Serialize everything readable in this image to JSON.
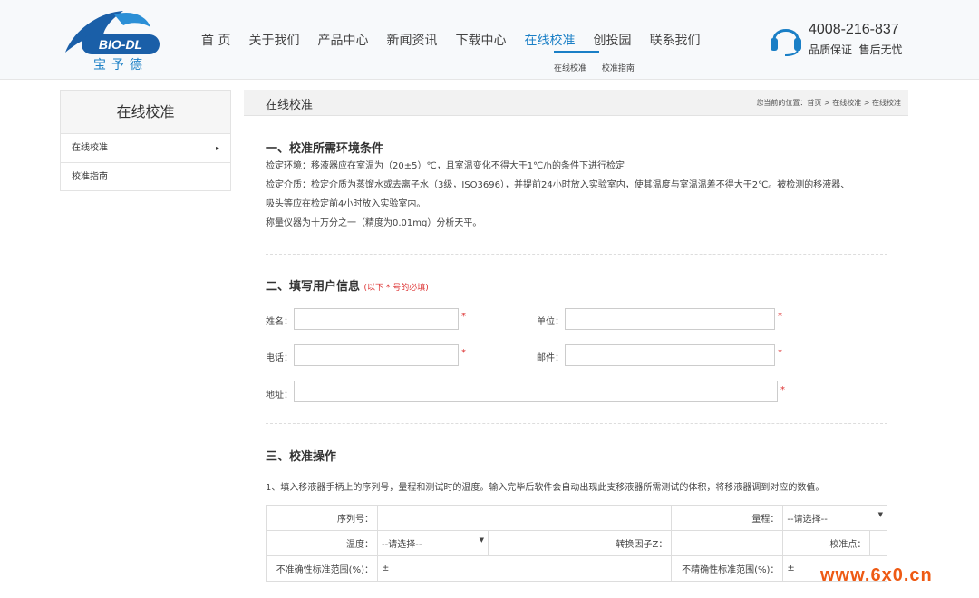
{
  "brand": {
    "logo_text": "BIO-DL",
    "logo_cn": "宝予德",
    "accent": "#1a7fc6"
  },
  "nav": {
    "items": [
      "首 页",
      "关于我们",
      "产品中心",
      "新闻资讯",
      "下载中心",
      "在线校准",
      "创投园",
      "联系我们"
    ],
    "active": "在线校准",
    "subnav": [
      "在线校准",
      "校准指南"
    ]
  },
  "hotline": {
    "number": "4008-216-837",
    "slogan": "品质保证  售后无忧"
  },
  "sidebar": {
    "title": "在线校准",
    "items": [
      {
        "label": "在线校准",
        "arrow": "▸"
      },
      {
        "label": "校准指南"
      }
    ]
  },
  "main": {
    "title": "在线校准",
    "breadcrumb": "您当前的位置：首页 > 在线校准 > 在线校准"
  },
  "section1": {
    "title": "一、校准所需环境条件",
    "lines": [
      "检定环境：移液器应在室温为（20±5）℃，且室温变化不得大于1℃/h的条件下进行检定",
      "检定介质：检定介质为蒸馏水或去离子水（3级，ISO3696），并提前24小时放入实验室内，使其温度与室温温差不得大于2℃。被检测的移液器、",
      "吸头等应在检定前4小时放入实验室内。",
      "称量仪器为十万分之一（精度为0.01mg）分析天平。"
    ]
  },
  "section2": {
    "title": "二、填写用户信息",
    "required_note": "(以下 * 号的必填)",
    "fields": {
      "name_label": "姓名：",
      "unit_label": "单位：",
      "phone_label": "电话：",
      "mail_label": "邮件：",
      "addr_label": "地址："
    },
    "star": "*"
  },
  "section3": {
    "title": "三、校准操作",
    "instruction": "1、填入移液器手柄上的序列号，量程和测试时的温度。输入完毕后软件会自动出现此支移液器所需测试的体积，将移液器调到对应的数值。",
    "table": {
      "serial_label": "序列号：",
      "range_label": "量程：",
      "range_select": "--请选择--",
      "temp_label": "温度：",
      "temp_select": "--请选择--",
      "factor_label": "转换因子Z：",
      "point_label": "校准点：",
      "uncert_label": "不准确性标准范围(%)：",
      "uncert_value": "±",
      "imprec_label": "不精确性标准范围(%)：",
      "imprec_value": "±",
      "arrow": "▼"
    }
  },
  "watermark": "www.6x0.cn"
}
